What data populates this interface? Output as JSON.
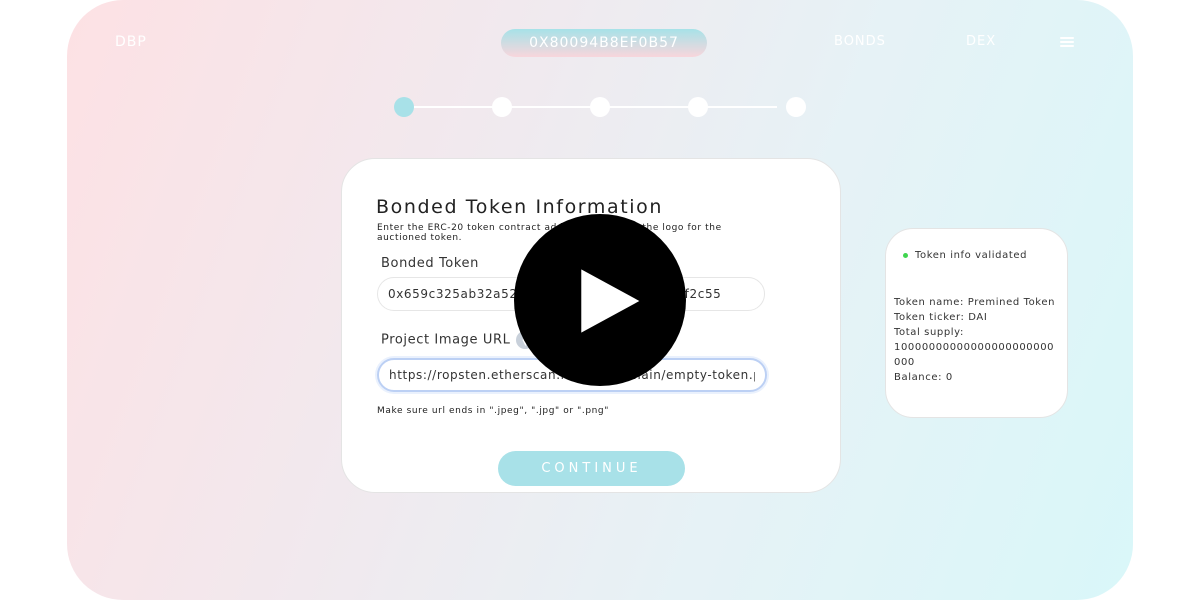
{
  "header": {
    "brand": "DBP",
    "wallet_address": "0X80094B8EF0B57",
    "nav": [
      {
        "label": "BONDS"
      },
      {
        "label": "DEX"
      }
    ],
    "menu_icon": "hamburger-icon"
  },
  "stepper": {
    "total_steps": 5,
    "current_step": 1
  },
  "form": {
    "title": "Bonded Token Information",
    "description": "Enter the ERC-20 token contract address and insert the logo for the auctioned token.",
    "bonded_token_label": "Bonded Token",
    "bonded_token_value": "0x659c325ab32a52b3d1a0c100b2f5c2d9d84f2c55",
    "project_image_label": "Project Image URL",
    "project_image_value": "https://ropsten.etherscan.io/images/main/empty-token.png",
    "hint": "Make sure url ends in \".jpeg\", \".jpg\" or \".png\"",
    "continue_label": "CONTINUE",
    "info_icon": "ethereum-icon"
  },
  "validation": {
    "status": "Token info validated",
    "status_color": "#3fd54f",
    "token_name": "Token name: Premined Token",
    "token_ticker": "Token ticker: DAI",
    "total_supply_label": "Total supply:",
    "total_supply_value": "10000000000000000000000000",
    "balance": "Balance: 0"
  },
  "overlay": {
    "icon": "play-icon"
  },
  "colors": {
    "accent": "#a8e1e8",
    "focus_border": "#bcd0f4"
  }
}
